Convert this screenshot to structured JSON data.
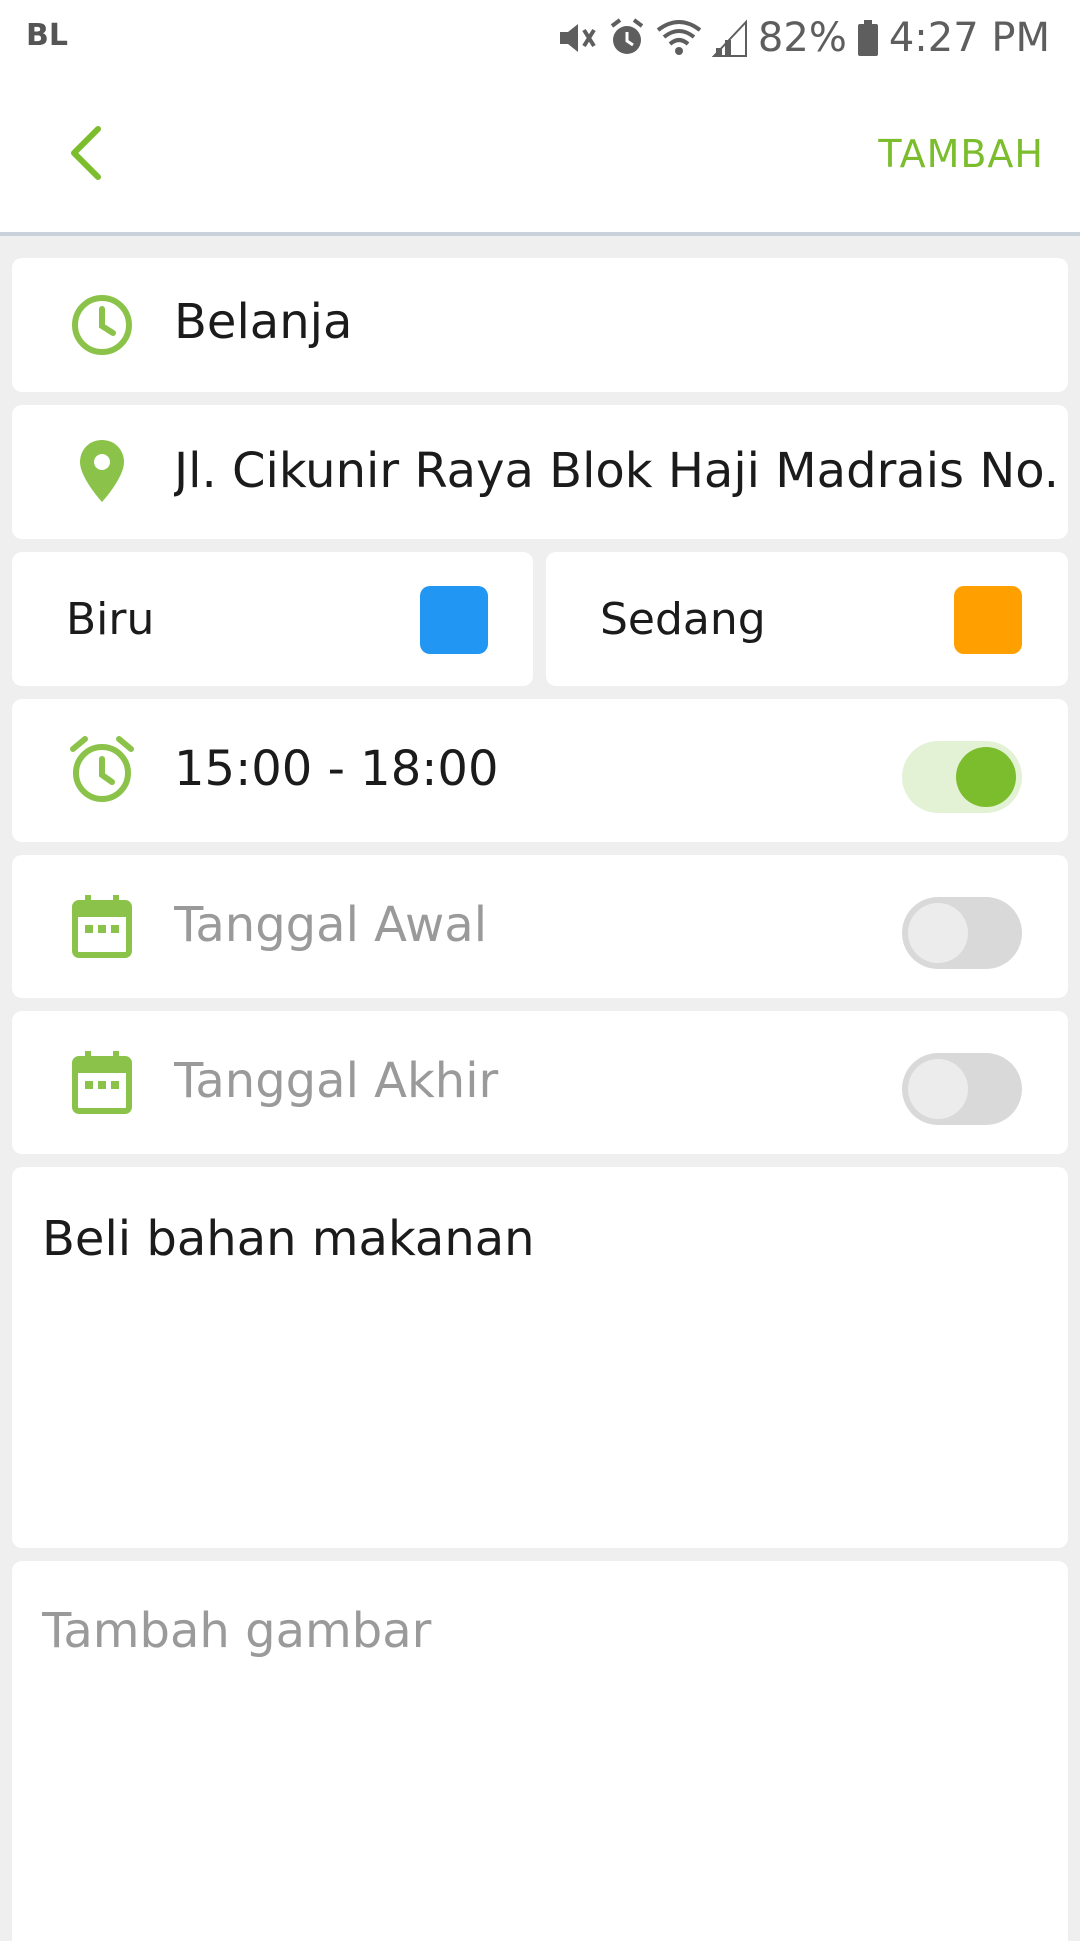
{
  "status_bar": {
    "carrier": "BL",
    "battery": "82%",
    "time": "4:27 PM"
  },
  "toolbar": {
    "back_icon": "chevron-left-icon",
    "action_label": "TAMBAH"
  },
  "form": {
    "title": {
      "icon": "clock-icon",
      "value": "Belanja"
    },
    "location": {
      "icon": "location-pin-icon",
      "value": "Jl. Cikunir Raya Blok Haji Madrais No."
    },
    "color": {
      "label": "Biru",
      "swatch": "#2196f3"
    },
    "priority": {
      "label": "Sedang",
      "swatch": "#ff9f00"
    },
    "time": {
      "icon": "alarm-clock-icon",
      "value": "15:00 - 18:00",
      "enabled": true
    },
    "start_date": {
      "icon": "calendar-icon",
      "placeholder": "Tanggal Awal",
      "enabled": false
    },
    "end_date": {
      "icon": "calendar-icon",
      "placeholder": "Tanggal Akhir",
      "enabled": false
    },
    "note": "Beli bahan makanan",
    "image_placeholder": "Tambah gambar"
  },
  "colors": {
    "accent": "#7bbd2c",
    "icon_green": "#8bc34a",
    "toggle_on_track": "#e3f1d5",
    "toggle_off_track": "#d9d9d9",
    "toggle_off_thumb": "#ececec"
  }
}
